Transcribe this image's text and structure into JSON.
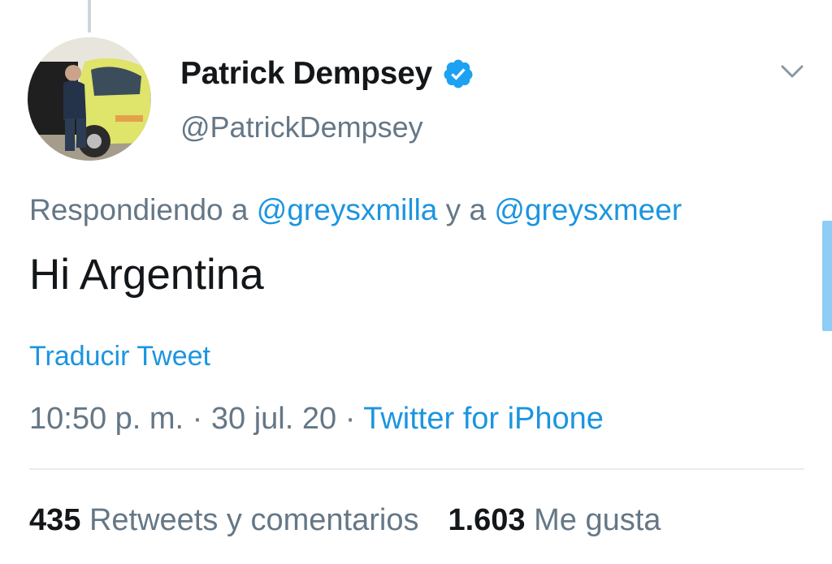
{
  "author": {
    "display_name": "Patrick Dempsey",
    "handle": "@PatrickDempsey",
    "verified_icon": "verified-badge-icon"
  },
  "reply": {
    "prefix": "Respondiendo a ",
    "mention_1": "@greysxmilla",
    "joiner": " y a ",
    "mention_2": "@greysxmeer"
  },
  "tweet": {
    "text": "Hi Argentina",
    "translate_label": "Traducir Tweet"
  },
  "meta": {
    "time": "10:50 p. m.",
    "sep_1": " · ",
    "date": "30 jul. 20",
    "sep_2": " · ",
    "source": "Twitter for iPhone"
  },
  "stats": {
    "retweets_count": "435",
    "retweets_label": " Retweets y comentarios",
    "likes_count": "1.603",
    "likes_label": " Me gusta"
  },
  "colors": {
    "link": "#1b95e0",
    "secondary_text": "#657786",
    "primary_text": "#14171a",
    "verified": "#1da1f2"
  }
}
